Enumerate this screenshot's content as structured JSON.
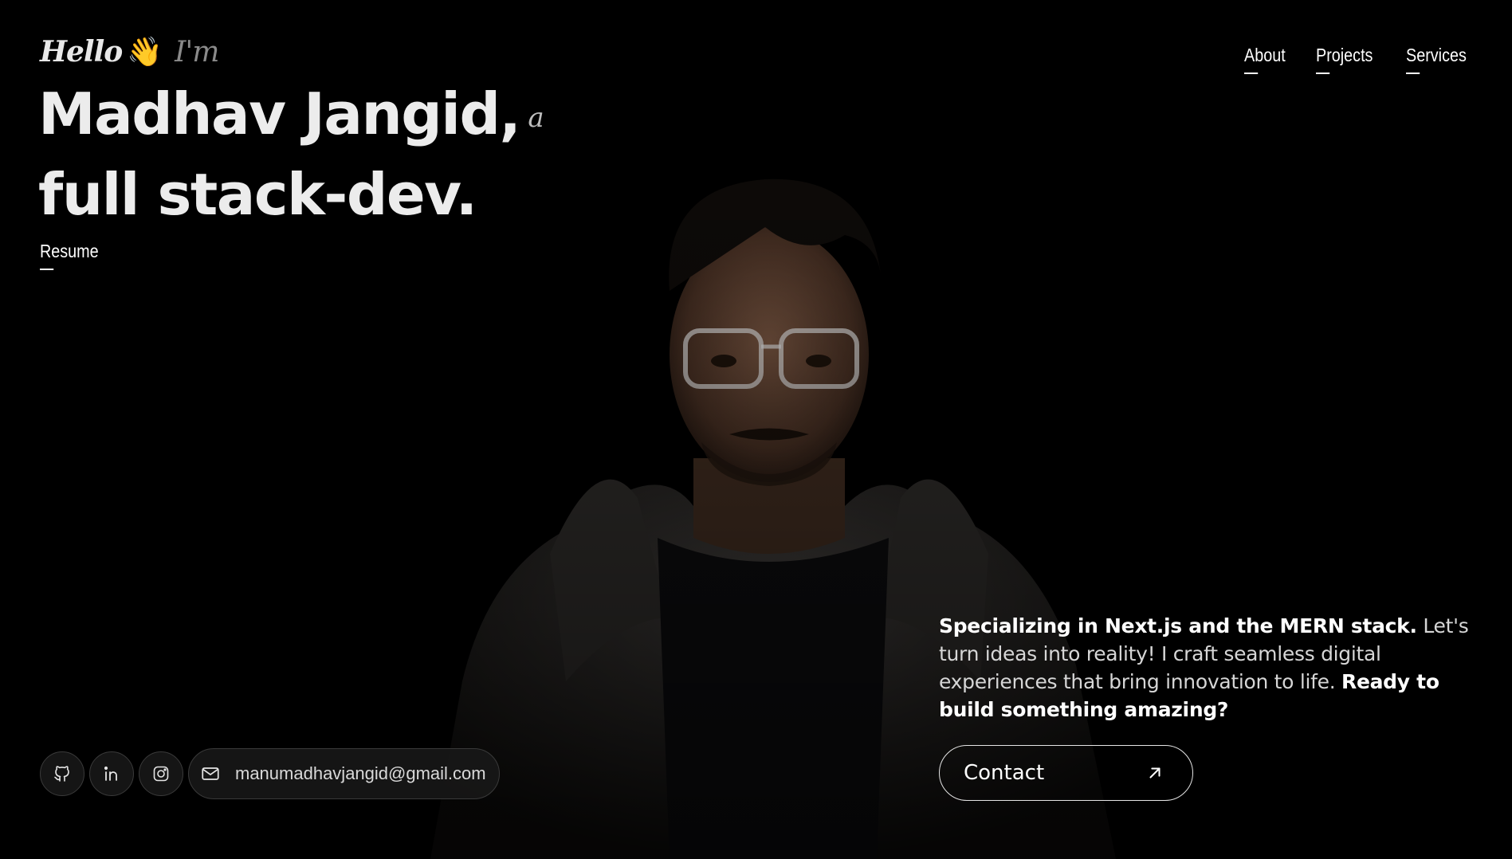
{
  "header": {
    "greeting_hello": "Hello",
    "greeting_wave": "👋",
    "greeting_im": "I'm",
    "headline_name": "Madhav Jangid,",
    "headline_a": "a",
    "headline_role": "full stack-dev.",
    "resume_label": "Resume"
  },
  "nav": {
    "items": [
      {
        "label": "About"
      },
      {
        "label": "Projects"
      },
      {
        "label": "Services"
      }
    ]
  },
  "social": {
    "icons": [
      "github-icon",
      "linkedin-icon",
      "instagram-icon"
    ],
    "email_icon": "mail-icon",
    "email": "manumadhavjangid@gmail.com"
  },
  "intro": {
    "bold_1": "Specializing in Next.js and the MERN stack.",
    "text_1": " Let's turn ideas into reality! I craft seamless digital experiences that bring innovation to life. ",
    "bold_2": "Ready to build something amazing?"
  },
  "contact": {
    "label": "Contact",
    "icon": "arrow-up-right-icon"
  },
  "colors": {
    "background": "#000000",
    "text_primary": "#ffffff",
    "text_muted": "#d6d6d6",
    "border": "#3a3a3a"
  }
}
